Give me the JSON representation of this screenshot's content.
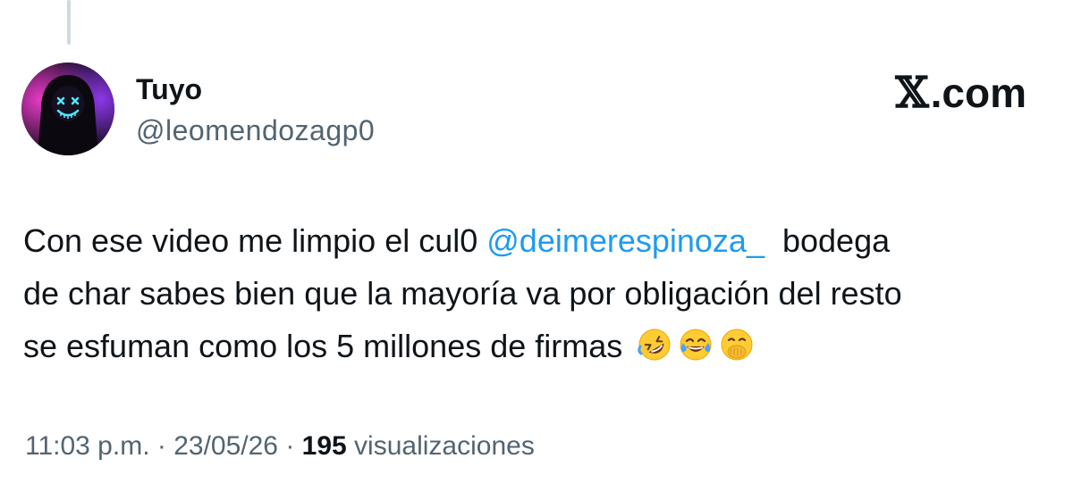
{
  "tweet": {
    "author": {
      "display_name": "Tuyo",
      "handle": "@leomendozagp0",
      "avatar_icon": "neon-masked-figure-avatar"
    },
    "brand": {
      "label": "𝕏.com",
      "x_glyph": "𝕏",
      "domain": ".com"
    },
    "text": {
      "line1_before": "Con ese video me limpio el cul0 ",
      "mention": "@deimerespinoza_",
      "line1_after": "  bodega",
      "line2": "de char sabes bien que la mayoría va por obligación del resto",
      "line3": "se esfuman como los 5 millones de firmas ",
      "emojis": [
        "rolling-on-floor-laughing-emoji",
        "face-with-tears-of-joy-emoji",
        "face-with-hand-over-mouth-emoji"
      ]
    },
    "meta": {
      "time": "11:03 p.m.",
      "separator": " · ",
      "date": "23/05/26",
      "views_count": "195",
      "views_label": " visualizaciones"
    }
  },
  "colors": {
    "text_primary": "#0f1419",
    "text_secondary": "#536471",
    "mention": "#1d9bf0",
    "thread_line": "#cfd9de"
  }
}
